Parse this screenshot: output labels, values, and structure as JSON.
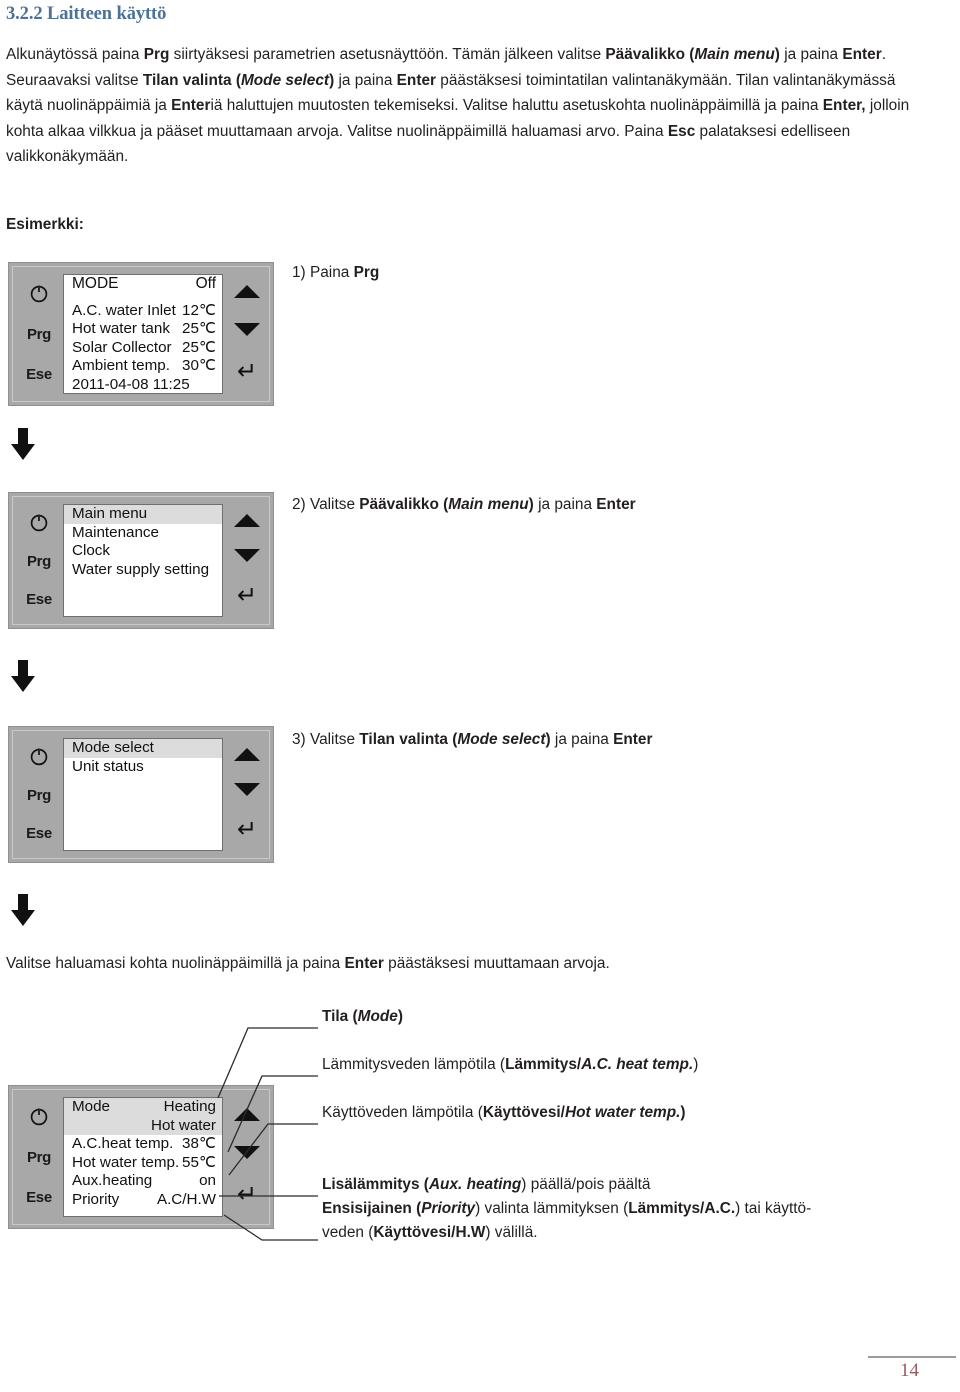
{
  "heading": "3.2.2 Laitteen käyttö",
  "intro": {
    "segments": [
      {
        "t": "Alkunäytössä paina ",
        "s": "n"
      },
      {
        "t": "Prg",
        "s": "b"
      },
      {
        "t": " siirtyäksesi parametrien asetusnäyttöön. Tämän jälkeen valitse ",
        "s": "n"
      },
      {
        "t": "Päävalikko (",
        "s": "b"
      },
      {
        "t": "Main menu",
        "s": "bi"
      },
      {
        "t": ")",
        "s": "b"
      },
      {
        "t": " ja paina ",
        "s": "n"
      },
      {
        "t": "Enter",
        "s": "b"
      },
      {
        "t": ". Seuraavaksi valitse ",
        "s": "n"
      },
      {
        "t": "Tilan valinta (",
        "s": "b"
      },
      {
        "t": "Mode select",
        "s": "bi"
      },
      {
        "t": ")",
        "s": "b"
      },
      {
        "t": " ja paina ",
        "s": "n"
      },
      {
        "t": "Enter",
        "s": "b"
      },
      {
        "t": " päästäksesi toimintatilan valintanäkymään.  Tilan valintanäkymässä käytä nuolinäppäimiä ja ",
        "s": "n"
      },
      {
        "t": "Enter",
        "s": "b"
      },
      {
        "t": "iä haluttujen muutosten tekemiseksi. Valitse haluttu asetuskohta nuolinäppäimillä ja paina ",
        "s": "n"
      },
      {
        "t": "Enter,",
        "s": "b"
      },
      {
        "t": " jolloin kohta alkaa vilkkua ja pääset muuttamaan arvoja. Valitse nuolinäppäimillä haluamasi arvo. Paina ",
        "s": "n"
      },
      {
        "t": "Esc",
        "s": "b"
      },
      {
        "t": " palataksesi edelliseen valikkonäkymään.",
        "s": "n"
      }
    ]
  },
  "esimerkki_label": "Esimerkki:",
  "keys": {
    "power_icon": "power-icon",
    "prg": "Prg",
    "ese": "Ese",
    "up_icon": "arrow-up-icon",
    "down_icon": "arrow-down-icon",
    "enter_icon": "enter-return-icon",
    "enter_glyph": "↵"
  },
  "panels": [
    {
      "id": "panel1",
      "rows": [
        {
          "label": "MODE",
          "value": "Off",
          "highlight": false
        },
        {
          "label": "",
          "value": "",
          "spacer": true
        },
        {
          "label": "A.C. water Inlet",
          "value": "12℃",
          "highlight": false
        },
        {
          "label": "Hot water tank",
          "value": "25℃",
          "highlight": false
        },
        {
          "label": "Solar Collector",
          "value": "25℃",
          "highlight": false
        },
        {
          "label": "Ambient temp.",
          "value": "30℃",
          "highlight": false
        },
        {
          "label": "2011-04-08   11:25",
          "value": "",
          "highlight": false
        }
      ]
    },
    {
      "id": "panel2",
      "rows": [
        {
          "label": "Main menu",
          "value": "",
          "highlight": true
        },
        {
          "label": "Maintenance",
          "value": "",
          "highlight": false
        },
        {
          "label": "Clock",
          "value": "",
          "highlight": false
        },
        {
          "label": "Water supply setting",
          "value": "",
          "highlight": false
        }
      ]
    },
    {
      "id": "panel3",
      "rows": [
        {
          "label": "Mode select",
          "value": "",
          "highlight": true
        },
        {
          "label": "Unit status",
          "value": "",
          "highlight": false
        }
      ]
    },
    {
      "id": "panel4",
      "rows": [
        {
          "label": "Mode",
          "value": "Heating",
          "highlight": true
        },
        {
          "label": "",
          "value": "Hot water",
          "highlight": true
        },
        {
          "label": "A.C.heat temp.",
          "value": "38℃",
          "highlight": false
        },
        {
          "label": "Hot water temp.",
          "value": "55℃",
          "highlight": false
        },
        {
          "label": "Aux.heating",
          "value": "on",
          "highlight": false
        },
        {
          "label": "Priority",
          "value": "A.C/H.W",
          "highlight": false
        }
      ]
    }
  ],
  "steps": [
    {
      "id": "step1",
      "segments": [
        {
          "t": "1) Paina ",
          "s": "n"
        },
        {
          "t": "Prg",
          "s": "b"
        }
      ]
    },
    {
      "id": "step2",
      "segments": [
        {
          "t": "2) Valitse ",
          "s": "n"
        },
        {
          "t": "Päävalikko (",
          "s": "b"
        },
        {
          "t": "Main menu",
          "s": "bi"
        },
        {
          "t": ")",
          "s": "b"
        },
        {
          "t": " ja paina ",
          "s": "n"
        },
        {
          "t": "Enter",
          "s": "b"
        }
      ]
    },
    {
      "id": "step3",
      "segments": [
        {
          "t": "3) Valitse ",
          "s": "n"
        },
        {
          "t": "Tilan valinta (",
          "s": "b"
        },
        {
          "t": "Mode select",
          "s": "bi"
        },
        {
          "t": ")",
          "s": "b"
        },
        {
          "t": " ja paina ",
          "s": "n"
        },
        {
          "t": "Enter",
          "s": "b"
        }
      ]
    }
  ],
  "mid_sentence": {
    "segments": [
      {
        "t": "Valitse haluamasi kohta nuolinäppäimillä ja paina ",
        "s": "n"
      },
      {
        "t": "Enter",
        "s": "b"
      },
      {
        "t": " päästäksesi muuttamaan arvoja.",
        "s": "n"
      }
    ]
  },
  "callouts": [
    {
      "id": "callout-mode",
      "segments": [
        {
          "t": "Tila (",
          "s": "b"
        },
        {
          "t": "Mode",
          "s": "bi"
        },
        {
          "t": ")",
          "s": "b"
        }
      ]
    },
    {
      "id": "callout-heat-temp",
      "segments": [
        {
          "t": " Lämmitysveden lämpötila (",
          "s": "n"
        },
        {
          "t": "Lämmitys/",
          "s": "b"
        },
        {
          "t": "A.C. heat temp.",
          "s": "bi"
        },
        {
          "t": ")",
          "s": "n"
        }
      ]
    },
    {
      "id": "callout-hot-water-temp",
      "segments": [
        {
          "t": "Käyttöveden lämpötila (",
          "s": "n"
        },
        {
          "t": "Käyttövesi/",
          "s": "b"
        },
        {
          "t": "Hot water temp.",
          "s": "bi"
        },
        {
          "t": ")",
          "s": "b"
        }
      ]
    },
    {
      "id": "callout-aux-priority",
      "segments": [
        {
          "t": "Lisälämmitys (",
          "s": "b"
        },
        {
          "t": "Aux. heating",
          "s": "bi"
        },
        {
          "t": ") päällä/pois päältä",
          "s": "n"
        },
        {
          "t": "\n",
          "s": "br"
        },
        {
          "t": "Ensisijainen (",
          "s": "b"
        },
        {
          "t": "Priority",
          "s": "bi"
        },
        {
          "t": ") valinta lämmityksen (",
          "s": "n"
        },
        {
          "t": "Lämmitys/A.C.",
          "s": "b"
        },
        {
          "t": ") tai käyttö-",
          "s": "n"
        },
        {
          "t": "\n",
          "s": "br"
        },
        {
          "t": "veden (",
          "s": "n"
        },
        {
          "t": "Käyttövesi/H.W",
          "s": "b"
        },
        {
          "t": ") välillä.",
          "s": "n"
        }
      ]
    }
  ],
  "footer": {
    "page_number": "14"
  },
  "colors": {
    "heading": "#4e7196",
    "page_number": "#9a5a62",
    "panel_body": "#a8a8a8",
    "lcd_background": "#ffffff",
    "lcd_highlight": "#dcdcdc",
    "text": "#231f20"
  }
}
